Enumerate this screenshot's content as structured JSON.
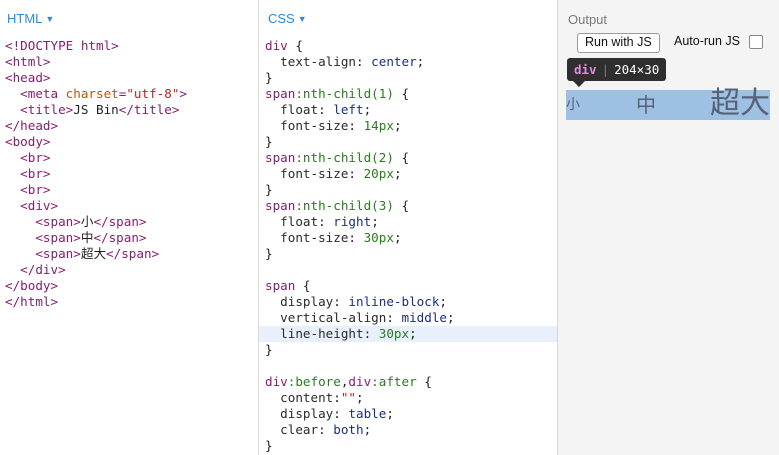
{
  "html_pane": {
    "title": "HTML",
    "lines": [
      [
        [
          "tag",
          "<!DOCTYPE html>"
        ]
      ],
      [
        [
          "tag",
          "<html>"
        ]
      ],
      [
        [
          "tag",
          "<head>"
        ]
      ],
      [
        [
          "txt",
          "  "
        ],
        [
          "tag",
          "<meta "
        ],
        [
          "attr",
          "charset"
        ],
        [
          "tag",
          "="
        ],
        [
          "str",
          "\"utf-8\""
        ],
        [
          "tag",
          ">"
        ]
      ],
      [
        [
          "txt",
          "  "
        ],
        [
          "tag",
          "<title>"
        ],
        [
          "txt",
          "JS Bin"
        ],
        [
          "tag",
          "</title>"
        ]
      ],
      [
        [
          "tag",
          "</head>"
        ]
      ],
      [
        [
          "tag",
          "<body>"
        ]
      ],
      [
        [
          "txt",
          "  "
        ],
        [
          "tag",
          "<br>"
        ]
      ],
      [
        [
          "txt",
          "  "
        ],
        [
          "tag",
          "<br>"
        ]
      ],
      [
        [
          "txt",
          "  "
        ],
        [
          "tag",
          "<br>"
        ]
      ],
      [
        [
          "txt",
          "  "
        ],
        [
          "tag",
          "<div>"
        ]
      ],
      [
        [
          "txt",
          "    "
        ],
        [
          "tag",
          "<span>"
        ],
        [
          "txt",
          "小"
        ],
        [
          "tag",
          "</span>"
        ]
      ],
      [
        [
          "txt",
          "    "
        ],
        [
          "tag",
          "<span>"
        ],
        [
          "txt",
          "中"
        ],
        [
          "tag",
          "</span>"
        ]
      ],
      [
        [
          "txt",
          "    "
        ],
        [
          "tag",
          "<span>"
        ],
        [
          "txt",
          "超大"
        ],
        [
          "tag",
          "</span>"
        ]
      ],
      [
        [
          "txt",
          "  "
        ],
        [
          "tag",
          "</div>"
        ]
      ],
      [
        [
          "tag",
          "</body>"
        ]
      ],
      [
        [
          "tag",
          "</html>"
        ]
      ]
    ]
  },
  "css_pane": {
    "title": "CSS",
    "highlight_line": 18,
    "lines": [
      [
        [
          "sel",
          "div"
        ],
        [
          "txt",
          " {"
        ]
      ],
      [
        [
          "txt",
          "  "
        ],
        [
          "prop",
          "text-align"
        ],
        [
          "txt",
          ": "
        ],
        [
          "val",
          "center"
        ],
        [
          "txt",
          ";"
        ]
      ],
      [
        [
          "txt",
          "}"
        ]
      ],
      [
        [
          "sel",
          "span"
        ],
        [
          "pseudo",
          ":nth-child(1)"
        ],
        [
          "txt",
          " {"
        ]
      ],
      [
        [
          "txt",
          "  "
        ],
        [
          "prop",
          "float"
        ],
        [
          "txt",
          ": "
        ],
        [
          "val",
          "left"
        ],
        [
          "txt",
          ";"
        ]
      ],
      [
        [
          "txt",
          "  "
        ],
        [
          "prop",
          "font-size"
        ],
        [
          "txt",
          ": "
        ],
        [
          "num",
          "14px"
        ],
        [
          "txt",
          ";"
        ]
      ],
      [
        [
          "txt",
          "}"
        ]
      ],
      [
        [
          "sel",
          "span"
        ],
        [
          "pseudo",
          ":nth-child(2)"
        ],
        [
          "txt",
          " {"
        ]
      ],
      [
        [
          "txt",
          "  "
        ],
        [
          "prop",
          "font-size"
        ],
        [
          "txt",
          ": "
        ],
        [
          "num",
          "20px"
        ],
        [
          "txt",
          ";"
        ]
      ],
      [
        [
          "txt",
          "}"
        ]
      ],
      [
        [
          "sel",
          "span"
        ],
        [
          "pseudo",
          ":nth-child(3)"
        ],
        [
          "txt",
          " {"
        ]
      ],
      [
        [
          "txt",
          "  "
        ],
        [
          "prop",
          "float"
        ],
        [
          "txt",
          ": "
        ],
        [
          "val",
          "right"
        ],
        [
          "txt",
          ";"
        ]
      ],
      [
        [
          "txt",
          "  "
        ],
        [
          "prop",
          "font-size"
        ],
        [
          "txt",
          ": "
        ],
        [
          "num",
          "30px"
        ],
        [
          "txt",
          ";"
        ]
      ],
      [
        [
          "txt",
          "}"
        ]
      ],
      [
        [
          "txt",
          ""
        ]
      ],
      [
        [
          "sel",
          "span"
        ],
        [
          "txt",
          " {"
        ]
      ],
      [
        [
          "txt",
          "  "
        ],
        [
          "prop",
          "display"
        ],
        [
          "txt",
          ": "
        ],
        [
          "val",
          "inline-block"
        ],
        [
          "txt",
          ";"
        ]
      ],
      [
        [
          "txt",
          "  "
        ],
        [
          "prop",
          "vertical-align"
        ],
        [
          "txt",
          ": "
        ],
        [
          "val",
          "middle"
        ],
        [
          "txt",
          ";"
        ]
      ],
      [
        [
          "txt",
          "  "
        ],
        [
          "prop",
          "line-height"
        ],
        [
          "txt",
          ": "
        ],
        [
          "num",
          "30px"
        ],
        [
          "txt",
          ";"
        ]
      ],
      [
        [
          "txt",
          "}"
        ]
      ],
      [
        [
          "txt",
          ""
        ]
      ],
      [
        [
          "sel",
          "div"
        ],
        [
          "pseudo",
          ":before"
        ],
        [
          "txt",
          ","
        ],
        [
          "sel",
          "div"
        ],
        [
          "pseudo",
          ":after"
        ],
        [
          "txt",
          " {"
        ]
      ],
      [
        [
          "txt",
          "  "
        ],
        [
          "prop",
          "content"
        ],
        [
          "txt",
          ":"
        ],
        [
          "str",
          "\"\""
        ],
        [
          "txt",
          ";"
        ]
      ],
      [
        [
          "txt",
          "  "
        ],
        [
          "prop",
          "display"
        ],
        [
          "txt",
          ": "
        ],
        [
          "val",
          "table"
        ],
        [
          "txt",
          ";"
        ]
      ],
      [
        [
          "txt",
          "  "
        ],
        [
          "prop",
          "clear"
        ],
        [
          "txt",
          ": "
        ],
        [
          "val",
          "both"
        ],
        [
          "txt",
          ";"
        ]
      ],
      [
        [
          "txt",
          "}"
        ]
      ]
    ]
  },
  "output_pane": {
    "title": "Output",
    "run_button_label": "Run with JS",
    "autorun_label": "Auto-run JS",
    "autorun_checked": false,
    "tooltip": {
      "tag": "div",
      "size": "204×30"
    },
    "spans": [
      "小",
      "中",
      "超大"
    ]
  },
  "colors": {
    "accent": "#2a8bd6",
    "highlight_bg": "#e7f0fb",
    "div_bg": "#9ec1e3",
    "tooltip_bg": "#2f2f2f"
  }
}
